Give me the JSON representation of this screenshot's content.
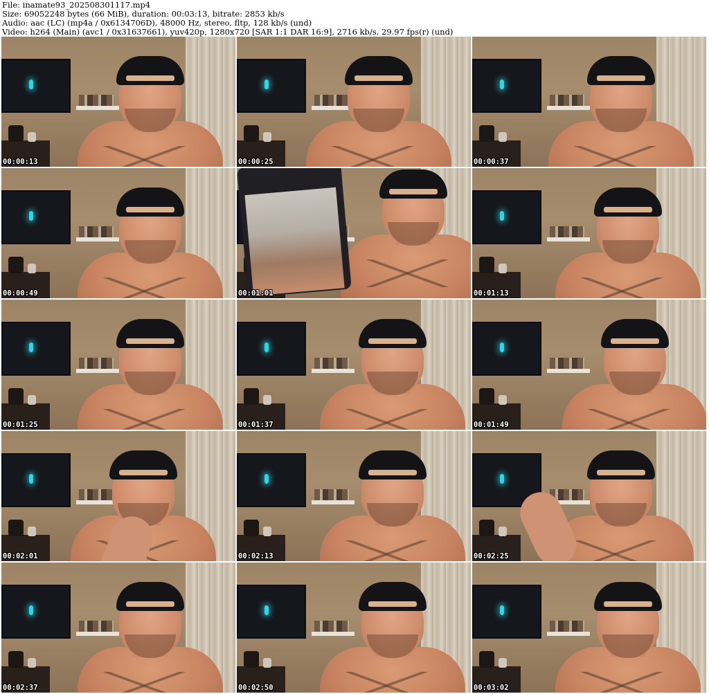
{
  "header": {
    "file": "File: inamate93_202508301117.mp4",
    "size": "Size: 69052248 bytes (66 MiB), duration: 00:03:13, bitrate: 2853 kb/s",
    "audio": "Audio: aac (LC) (mp4a / 0x6134706D), 48000 Hz, stereo, fltp, 128 kb/s (und)",
    "video": "Video: h264 (Main) (avc1 / 0x31637661), yuv420p, 1280x720 [SAR 1:1 DAR 16:9], 2716 kb/s, 29.97 fps(r) (und)"
  },
  "thumbnails": [
    {
      "timestamp": "00:00:13",
      "variant": "normal"
    },
    {
      "timestamp": "00:00:25",
      "variant": "normal"
    },
    {
      "timestamp": "00:00:37",
      "variant": "normal"
    },
    {
      "timestamp": "00:00:49",
      "variant": "normal"
    },
    {
      "timestamp": "00:01:01",
      "variant": "phone"
    },
    {
      "timestamp": "00:01:13",
      "variant": "normal"
    },
    {
      "timestamp": "00:01:25",
      "variant": "normal"
    },
    {
      "timestamp": "00:01:37",
      "variant": "normal"
    },
    {
      "timestamp": "00:01:49",
      "variant": "normal"
    },
    {
      "timestamp": "00:02:01",
      "variant": "hand"
    },
    {
      "timestamp": "00:02:13",
      "variant": "normal"
    },
    {
      "timestamp": "00:02:25",
      "variant": "arm"
    },
    {
      "timestamp": "00:02:37",
      "variant": "normal"
    },
    {
      "timestamp": "00:02:50",
      "variant": "normal"
    },
    {
      "timestamp": "00:03:02",
      "variant": "normal"
    }
  ],
  "colors": {
    "background": "#ffffff",
    "timestamp_text": "#ffffff",
    "tv_led": "#2fd6e6"
  }
}
